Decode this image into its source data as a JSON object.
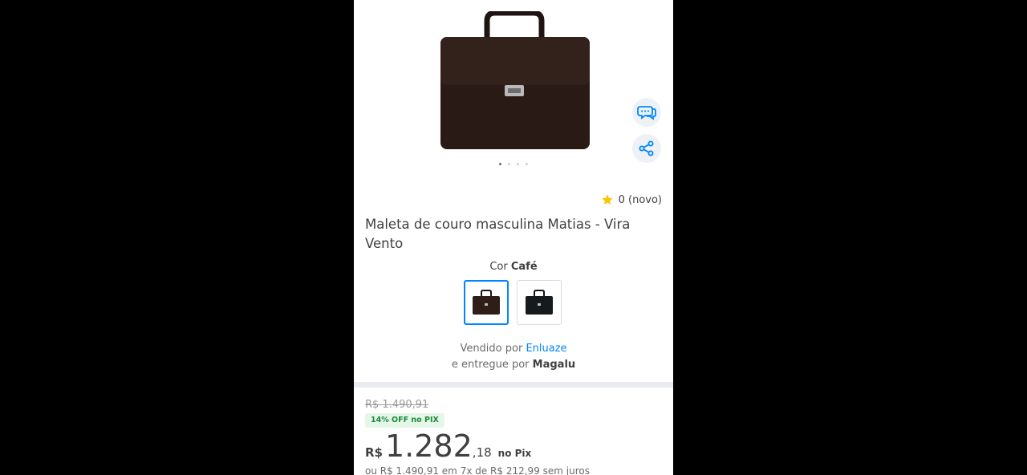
{
  "product": {
    "title": "Maleta de couro masculina Matias - Vira Vento",
    "rating": "0 (novo)",
    "gallery_total": 4,
    "gallery_active": 1,
    "color_label": "Cor",
    "color_value": "Café",
    "colors": [
      "Café",
      "Preto"
    ]
  },
  "seller": {
    "sold_by_prefix": "Vendido por",
    "sold_by_name": "Enluaze",
    "delivered_prefix": "e entregue por",
    "delivered_name": "Magalu"
  },
  "pricing": {
    "old_price": "R$ 1.490,91",
    "discount_badge": "14% OFF no PIX",
    "currency": "R$",
    "price_integer": "1.282",
    "price_cents": ",18",
    "price_suffix": "no Pix",
    "installments": "ou R$ 1.490,91 em 7x de R$ 212,99 sem juros"
  },
  "colors": {
    "accent": "#0086ff",
    "star": "#f7c600",
    "badge_bg": "#e4f7e8",
    "badge_text": "#1b8a3a"
  }
}
